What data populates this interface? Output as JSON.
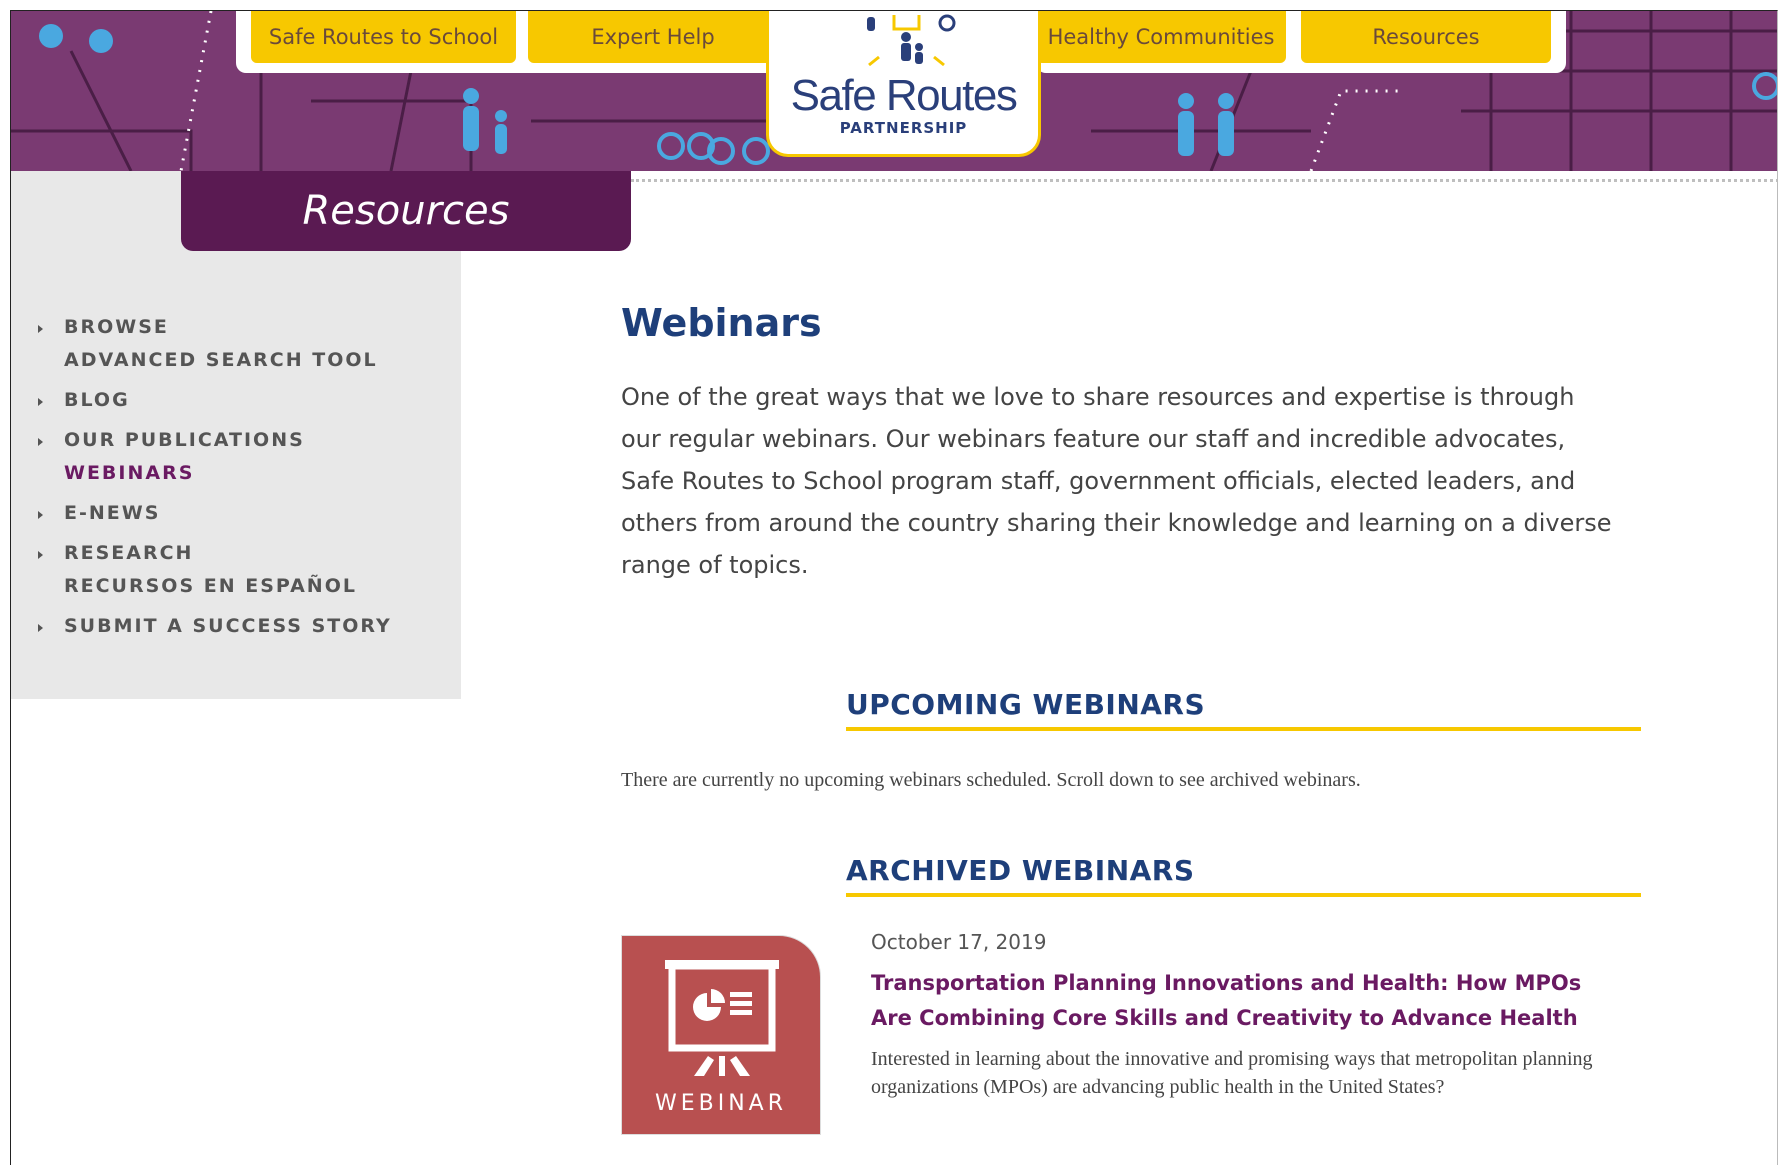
{
  "nav": {
    "left_tabs": [
      "Safe Routes to School",
      "Expert Help"
    ],
    "right_tabs": [
      "Healthy Communities",
      "Resources"
    ]
  },
  "logo": {
    "main": "Safe Routes",
    "sub": "PARTNERSHIP"
  },
  "section_tab": "Resources",
  "sidebar": {
    "items": [
      {
        "label": "BROWSE",
        "bullet": true
      },
      {
        "label": "ADVANCED SEARCH TOOL",
        "bullet": false
      },
      {
        "label": "BLOG",
        "bullet": true
      },
      {
        "label": "OUR PUBLICATIONS",
        "bullet": true
      },
      {
        "label": "WEBINARS",
        "bullet": false,
        "active": true
      },
      {
        "label": "E-NEWS",
        "bullet": true
      },
      {
        "label": "RESEARCH",
        "bullet": true
      },
      {
        "label": "RECURSOS EN ESPAÑOL",
        "bullet": false
      },
      {
        "label": "SUBMIT A SUCCESS STORY",
        "bullet": true
      }
    ]
  },
  "main": {
    "title": "Webinars",
    "intro": "One of the great ways that we love to share resources and expertise is through our regular webinars. Our webinars feature our staff and incredible advocates, Safe Routes to School program staff, government officials, elected leaders, and others from around the country sharing their knowledge and learning on a diverse range of topics.",
    "upcoming_heading": "UPCOMING WEBINARS",
    "upcoming_text": "There are currently no upcoming webinars scheduled. Scroll down to see archived webinars.",
    "archived_heading": "ARCHIVED WEBINARS",
    "archived": [
      {
        "date": "October 17, 2019",
        "title": "Transportation Planning Innovations and Health: How MPOs Are Combining Core Skills and Creativity to Advance Health",
        "description": "Interested in learning about the innovative and promising ways that metropolitan planning organizations (MPOs) are advancing public health in the United States?",
        "thumb_label": "WEBINAR"
      }
    ]
  },
  "colors": {
    "purple": "#7a3a72",
    "dark_purple": "#5a1a52",
    "yellow": "#f7c800",
    "navy": "#1e3f7a",
    "webinar_red": "#b85050"
  }
}
